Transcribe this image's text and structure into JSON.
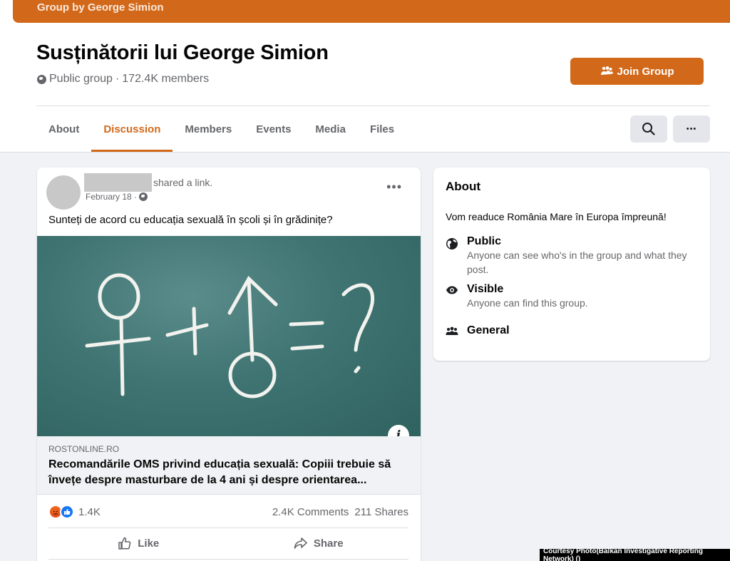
{
  "header": {
    "banner_text": "Group by George Simion",
    "group_name": "Susținătorii lui George Simion",
    "privacy": "Public group",
    "separator": " · ",
    "members": "172.4K members",
    "join_label": "Join Group"
  },
  "tabs": [
    {
      "label": "About",
      "active": false
    },
    {
      "label": "Discussion",
      "active": true
    },
    {
      "label": "Members",
      "active": false
    },
    {
      "label": "Events",
      "active": false
    },
    {
      "label": "Media",
      "active": false
    },
    {
      "label": "Files",
      "active": false
    }
  ],
  "toolbar": {
    "search_icon": "search-icon",
    "more_icon": "more-horizontal-icon",
    "more_label": "•••"
  },
  "post": {
    "action_text": "shared a link.",
    "date": "February 18 ·",
    "more_label": "•••",
    "text": "Sunteți de acord cu educația sexuală în școli și în grădinițe?",
    "image_description": "Chalkboard: ♀ + ♂ = ?",
    "info_label": "i",
    "link": {
      "domain": "ROSTONLINE.RO",
      "title": "Recomandările OMS privind educația sexuală: Copiii trebuie să învețe despre masturbare de la 4 ani și despre orientarea..."
    },
    "reactions": {
      "types": [
        "angry",
        "like"
      ],
      "count": "1.4K",
      "comments": "2.4K Comments",
      "shares": "211 Shares"
    },
    "actions": {
      "like_label": "Like",
      "share_label": "Share"
    }
  },
  "about": {
    "heading": "About",
    "description": "Vom readuce România Mare în Europa împreună!",
    "items": [
      {
        "icon": "globe-icon",
        "title": "Public",
        "detail": "Anyone can see who's in the group and what they post."
      },
      {
        "icon": "eye-icon",
        "title": "Visible",
        "detail": "Anyone can find this group."
      },
      {
        "icon": "people-icon",
        "title": "General",
        "detail": ""
      }
    ]
  },
  "credit": "Courtesy Photo(Balkan Investigative Reporting Network) ()",
  "colors": {
    "accent": "#d2691a",
    "background": "#f0f2f5",
    "muted_text": "#65676b",
    "chalkboard": "#3f7472"
  }
}
